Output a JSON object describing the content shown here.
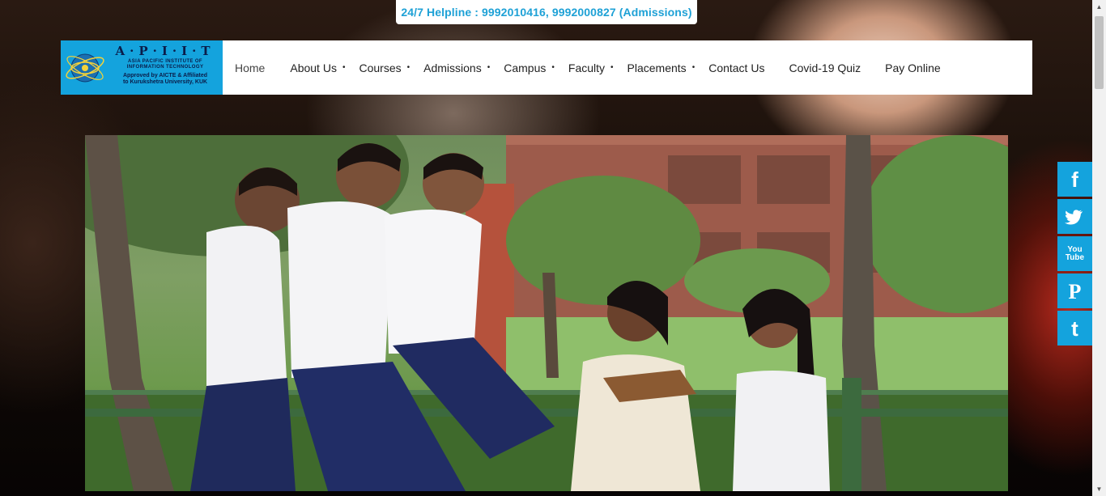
{
  "helpline": "24/7 Helpline : 9992010416, 9992000827 (Admissions)",
  "logo": {
    "brand": "A·P·I·I·T",
    "line1": "ASIA PACIFIC INSTITUTE OF",
    "line2": "INFORMATION TECHNOLOGY",
    "line3": "Approved by AICTE & Affiliated",
    "line4": "to Kurukshetra University, KUK"
  },
  "nav": {
    "items": [
      {
        "label": "Home",
        "dropdown": false
      },
      {
        "label": "About Us",
        "dropdown": true
      },
      {
        "label": "Courses",
        "dropdown": true
      },
      {
        "label": "Admissions",
        "dropdown": true
      },
      {
        "label": "Campus",
        "dropdown": true
      },
      {
        "label": "Faculty",
        "dropdown": true
      },
      {
        "label": "Placements",
        "dropdown": true
      },
      {
        "label": "Contact Us",
        "dropdown": false
      },
      {
        "label": "Covid-19 Quiz",
        "dropdown": false
      },
      {
        "label": "Pay Online",
        "dropdown": false
      }
    ],
    "dot": "•"
  },
  "social": [
    {
      "name": "facebook-icon",
      "glyph": "f"
    },
    {
      "name": "twitter-icon",
      "glyph": ""
    },
    {
      "name": "youtube-icon",
      "glyph": "You\nTube"
    },
    {
      "name": "pinterest-icon",
      "glyph": "P"
    },
    {
      "name": "tumblr-icon",
      "glyph": "t"
    }
  ],
  "colors": {
    "accent": "#14a3dd",
    "helpline_text": "#1ea1d6",
    "nav_bg": "#ffffff"
  }
}
